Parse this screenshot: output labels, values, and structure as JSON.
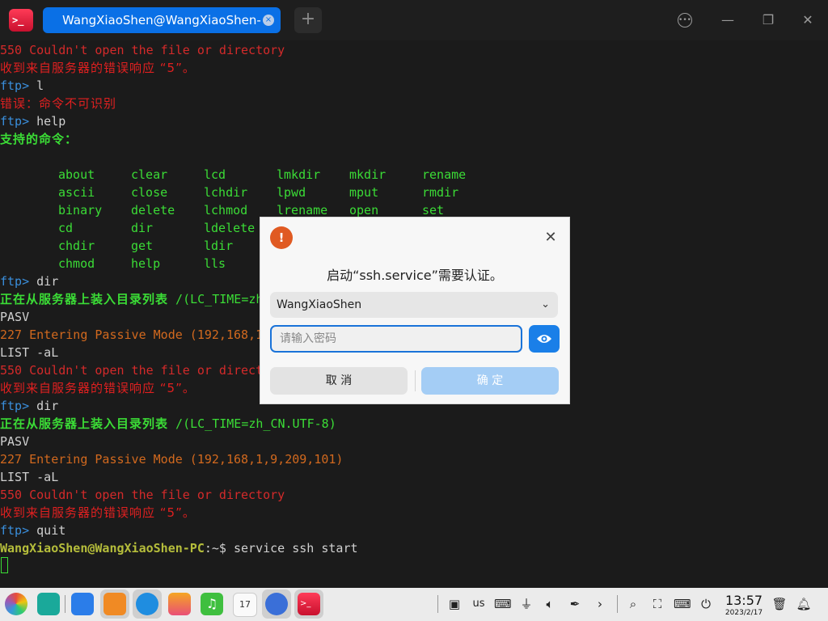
{
  "titlebar": {
    "app_icon_text": ">_",
    "tab_title": "WangXiaoShen@WangXiaoShen-PC: ~",
    "tab_close": "×",
    "new_tab": "+",
    "menu": "•••",
    "minimize": "—",
    "maximize": "❐",
    "close": "✕"
  },
  "terminal": {
    "lines": [
      {
        "text": "550 Couldn't open the file or directory",
        "style": "red"
      },
      {
        "text": "收到来自服务器的错误响应 “5”。",
        "style": "cnred"
      },
      {
        "prompt": "ftp>",
        "text": " l"
      },
      {
        "text": "错误：命令不可识别",
        "style": "cnred"
      },
      {
        "prompt": "ftp>",
        "text": " help"
      },
      {
        "text": "支持的命令：",
        "style": "cngreen"
      },
      {
        "prompt": "ftp>",
        "text": " dir"
      },
      {
        "text": "正在从服务器上装入目录列表",
        "suffix": " /(LC_TIME=zh_CN.UTF-8)",
        "style": "cngreen"
      },
      {
        "text": "PASV",
        "style": "grey"
      },
      {
        "text": "227 Entering Passive Mode (192,168,1,9,209,101)",
        "style": "orange"
      },
      {
        "text": "LIST -aL",
        "style": "grey"
      },
      {
        "text": "550 Couldn't open the file or directory",
        "style": "red"
      },
      {
        "text": "收到来自服务器的错误响应 “5”。",
        "style": "cnred"
      },
      {
        "prompt": "ftp>",
        "text": " dir"
      },
      {
        "text": "正在从服务器上装入目录列表",
        "suffix": " /(LC_TIME=zh_CN.UTF-8)",
        "style": "cngreen"
      },
      {
        "text": "PASV",
        "style": "grey"
      },
      {
        "text": "227 Entering Passive Mode (192,168,1,9,209,101)",
        "style": "orange"
      },
      {
        "text": "LIST -aL",
        "style": "grey"
      },
      {
        "text": "550 Couldn't open the file or directory",
        "style": "red"
      },
      {
        "text": "收到来自服务器的错误响应 “5”。",
        "style": "cnred"
      },
      {
        "prompt": "ftp>",
        "text": " quit"
      }
    ],
    "commands": [
      [
        "about",
        "clear",
        "lcd",
        "lmkdir",
        "mkdir",
        "rename"
      ],
      [
        "ascii",
        "close",
        "lchdir",
        "lpwd",
        "mput",
        "rmdir"
      ],
      [
        "binary",
        "delete",
        "lchmod",
        "lrename",
        "open",
        "set"
      ],
      [
        "cd",
        "dir",
        "ldelete",
        "",
        "",
        ""
      ],
      [
        "chdir",
        "get",
        "ldir",
        "",
        "",
        ""
      ],
      [
        "chmod",
        "help",
        "lls",
        "",
        "",
        ""
      ]
    ],
    "shell_user": "WangXiaoShen@WangXiaoShen-PC",
    "shell_path": ":~$",
    "shell_command": " service ssh start"
  },
  "dialog": {
    "title": "启动“ssh.service”需要认证。",
    "user": "WangXiaoShen",
    "password_placeholder": "请输入密码",
    "cancel": "取 消",
    "confirm": "确 定",
    "close": "✕",
    "warn_icon": "!"
  },
  "dock": {
    "lang": "us",
    "time": "13:57",
    "date": "2023/2/17",
    "calendar_day": "17"
  },
  "colors": {
    "accent": "#0a70e6",
    "terminal_bg": "#1b1b1b",
    "error_red": "#d42a2a",
    "prompt_blue": "#3a8edb",
    "ok_green": "#3bdc36"
  }
}
